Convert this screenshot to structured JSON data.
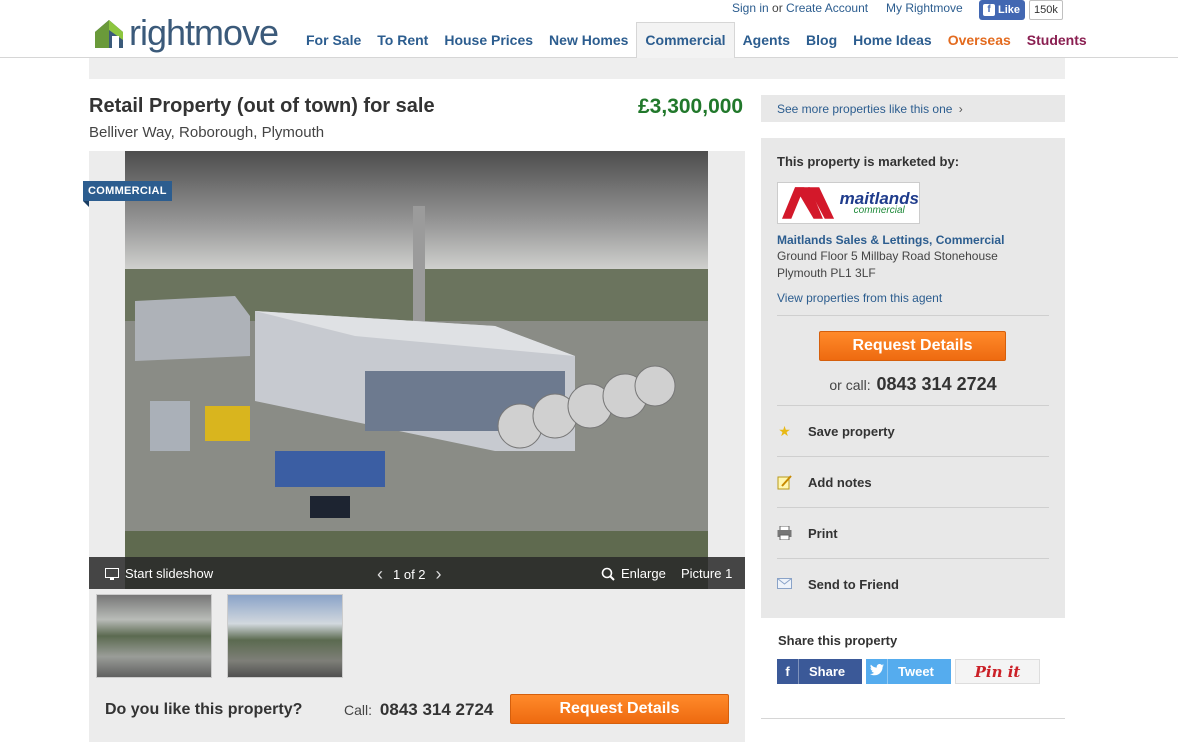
{
  "header": {
    "logo_text": "rightmove",
    "sign_in": "Sign in",
    "or_text": " or ",
    "create_account": "Create Account",
    "my_rightmove": "My Rightmove",
    "fb_like": "Like",
    "fb_count": "150k",
    "nav": [
      {
        "label": "For Sale"
      },
      {
        "label": "To Rent"
      },
      {
        "label": "House Prices"
      },
      {
        "label": "New Homes"
      },
      {
        "label": "Commercial"
      },
      {
        "label": "Agents"
      },
      {
        "label": "Blog"
      },
      {
        "label": "Home Ideas"
      },
      {
        "label": "Overseas"
      },
      {
        "label": "Students"
      }
    ],
    "active_nav": "Commercial",
    "colors": {
      "brand": "#3b5a7a",
      "nav": "#2c5d8f",
      "overseas": "#e36b1f",
      "students": "#8a1f51"
    }
  },
  "property": {
    "title": "Retail Property (out of town) for sale",
    "address": "Belliver Way, Roborough, Plymouth",
    "price": "£3,300,000",
    "badge": "COMMERCIAL"
  },
  "gallery": {
    "slideshow_label": "Start slideshow",
    "counter": "1 of 2",
    "enlarge_label": "Enlarge",
    "picture_label": "Picture 1"
  },
  "cta": {
    "question": "Do you like this property?",
    "call_label": "Call:",
    "phone": "0843 314 2724",
    "request_label": "Request Details"
  },
  "sidebar": {
    "see_more": "See more properties like this one",
    "marketed_by": "This property is marketed by:",
    "agent_logo_line1": "maitlands",
    "agent_logo_line2": "commercial",
    "agent_name": "Maitlands Sales & Lettings, Commercial",
    "agent_address_1": "Ground Floor 5 Millbay Road Stonehouse",
    "agent_address_2": "Plymouth PL1 3LF",
    "view_properties": "View properties from this agent",
    "request_label": "Request Details",
    "or_call": "or call:",
    "phone": "0843 314 2724",
    "actions": [
      {
        "label": "Save property",
        "icon": "star-icon"
      },
      {
        "label": "Add notes",
        "icon": "notes-icon"
      },
      {
        "label": "Print",
        "icon": "printer-icon"
      },
      {
        "label": "Send to Friend",
        "icon": "envelope-icon"
      }
    ]
  },
  "share": {
    "title": "Share this property",
    "facebook": "Share",
    "twitter": "Tweet",
    "pinterest": "Pin it"
  }
}
